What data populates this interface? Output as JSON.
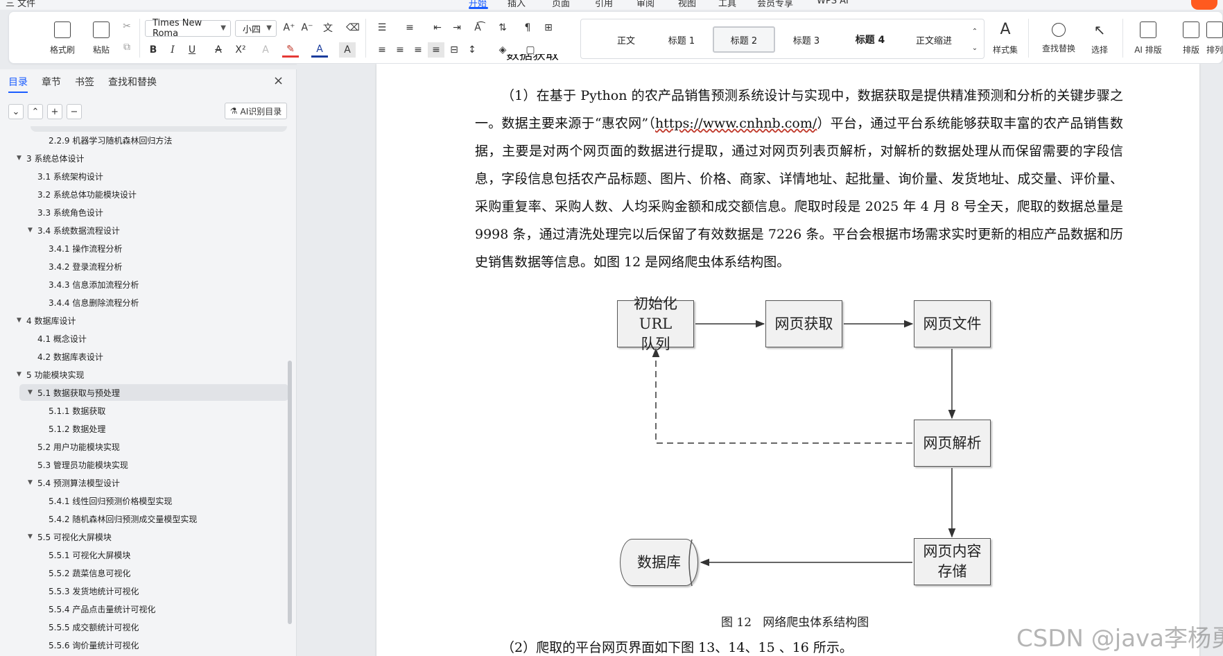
{
  "menubar": {
    "tabs": [
      "三 文件",
      "开始",
      "插入",
      "页面",
      "引用",
      "审阅",
      "视图",
      "工具",
      "会员专享",
      "WPS AI"
    ],
    "active": "开始"
  },
  "ribbon": {
    "format_painter": "格式刷",
    "paste": "粘贴",
    "font_name": "Times New Roma",
    "font_size": "小四",
    "style_gallery": [
      "正文",
      "标题 1",
      "标题 2",
      "标题 3",
      "标题 4",
      "正文缩进"
    ],
    "selected_style": "标题 2",
    "style_set": "样式集",
    "find_replace": "查找替换",
    "select": "选择",
    "ai_layout": "AI 排版",
    "layout": "排版",
    "arrange": "排列"
  },
  "nav": {
    "tabs": [
      "目录",
      "章节",
      "书签",
      "查找和替换"
    ],
    "active_tab": "目录",
    "ai_toc_button": "AI识别目录",
    "items": [
      {
        "text": "2.2.9  机器学习随机森林回归方法",
        "level": 3,
        "caret": ""
      },
      {
        "text": "3 系统总体设计",
        "level": 1,
        "caret": "▼"
      },
      {
        "text": "3.1  系统架构设计",
        "level": 2,
        "caret": ""
      },
      {
        "text": "3.2  系统总体功能模块设计",
        "level": 2,
        "caret": ""
      },
      {
        "text": "3.3  系统角色设计",
        "level": 2,
        "caret": ""
      },
      {
        "text": "3.4  系统数据流程设计",
        "level": 2,
        "caret": "▼"
      },
      {
        "text": "3.4.1 操作流程分析",
        "level": 3,
        "caret": ""
      },
      {
        "text": "3.4.2 登录流程分析",
        "level": 3,
        "caret": ""
      },
      {
        "text": "3.4.3 信息添加流程分析",
        "level": 3,
        "caret": ""
      },
      {
        "text": "3.4.4 信息删除流程分析",
        "level": 3,
        "caret": ""
      },
      {
        "text": "4  数据库设计",
        "level": 1,
        "caret": "▼"
      },
      {
        "text": "4.1 概念设计",
        "level": 2,
        "caret": ""
      },
      {
        "text": "4.2 数据库表设计",
        "level": 2,
        "caret": ""
      },
      {
        "text": "5  功能模块实现",
        "level": 1,
        "caret": "▼"
      },
      {
        "text": "5.1  数据获取与预处理",
        "level": 2,
        "caret": "▼",
        "selected": true
      },
      {
        "text": "5.1.1 数据获取",
        "level": 3,
        "caret": ""
      },
      {
        "text": "5.1.2 数据处理",
        "level": 3,
        "caret": ""
      },
      {
        "text": "5.2  用户功能模块实现",
        "level": 2,
        "caret": ""
      },
      {
        "text": "5.3  管理员功能模块实现",
        "level": 2,
        "caret": ""
      },
      {
        "text": "5.4  预测算法模型设计",
        "level": 2,
        "caret": "▼"
      },
      {
        "text": "5.4.1  线性回归预测价格模型实现",
        "level": 3,
        "caret": ""
      },
      {
        "text": "5.4.2  随机森林回归预测成交量模型实现",
        "level": 3,
        "caret": ""
      },
      {
        "text": "5.5  可视化大屏模块",
        "level": 2,
        "caret": "▼"
      },
      {
        "text": "5.5.1 可视化大屏模块",
        "level": 3,
        "caret": ""
      },
      {
        "text": "5.5.2  蔬菜信息可视化",
        "level": 3,
        "caret": ""
      },
      {
        "text": "5.5.3  发货地统计可视化",
        "level": 3,
        "caret": ""
      },
      {
        "text": "5.5.4  产品点击量统计可视化",
        "level": 3,
        "caret": ""
      },
      {
        "text": "5.5.5  成交额统计可视化",
        "level": 3,
        "caret": ""
      },
      {
        "text": "5.5.6  询价量统计可视化",
        "level": 3,
        "caret": ""
      }
    ]
  },
  "doc": {
    "top_fragment": "数据获取",
    "para1_before_url": "（1）在基于 Python 的农产品销售预测系统设计与实现中，数据获取是提供精准预测和分析的关键步骤之一。数据主要来源于“惠农网”（",
    "para1_url": "https://www.cnhnb.com/",
    "para1_after_url": "）平台，通过平台系统能够获取丰富的农产品销售数据，主要是对两个网页面的数据进行提取，通过对网页列表页解析，对解析的数据处理从而保留需要的字段信息，字段信息包括农产品标题、图片、价格、商家、详情地址、起批量、询价量、发货地址、成交量、评价量、采购重复率、采购人数、人均采购金额和成交额信息。爬取时段是 2025 年 4 月 8 号全天，爬取的数据总量是 9998 条，通过清洗处理完以后保留了有效数据是 7226 条。平台会根据市场需求实时更新的相应产品数据和历史销售数据等信息。如图 12 是网络爬虫体系结构图。",
    "para2": "（2）爬取的平台网页界面如下图 13、14、15 、16 所示。"
  },
  "diagram": {
    "nodes": {
      "init_url": "初始化URL\n队列",
      "fetch": "网页获取",
      "file": "网页文件",
      "parse": "网页解析",
      "store": "网页内容\n存储",
      "db": "数据库"
    },
    "caption": "图 12   网络爬虫体系结构图"
  },
  "watermark": "CSDN @java李杨勇"
}
